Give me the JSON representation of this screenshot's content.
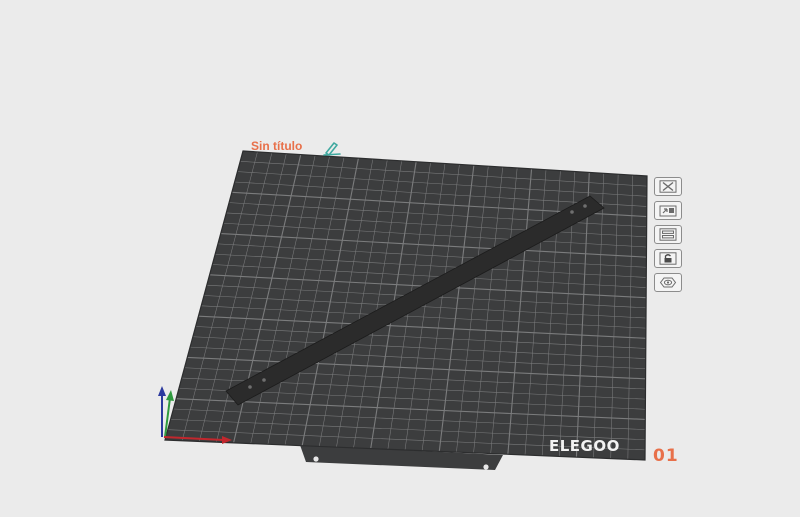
{
  "plate": {
    "title": "Sin título",
    "brand": "ELEGOO",
    "number": "01"
  },
  "icons": {
    "edit": "pencil-edit-icon",
    "delete": "close-icon",
    "arrange": "arrange-icon",
    "layout": "layout-icon",
    "lock": "lock-icon",
    "visibility": "eye-icon"
  },
  "colors": {
    "background": "#ebebeb",
    "plate": "#3c3d3e",
    "grid": "#7b7c7d",
    "title": "#e8704a",
    "edit_icon": "#3fa9a0",
    "model": "#2b2b2b",
    "axis_x": "#c1272d",
    "axis_y": "#2f9a3f",
    "axis_z": "#2c3a9e"
  }
}
